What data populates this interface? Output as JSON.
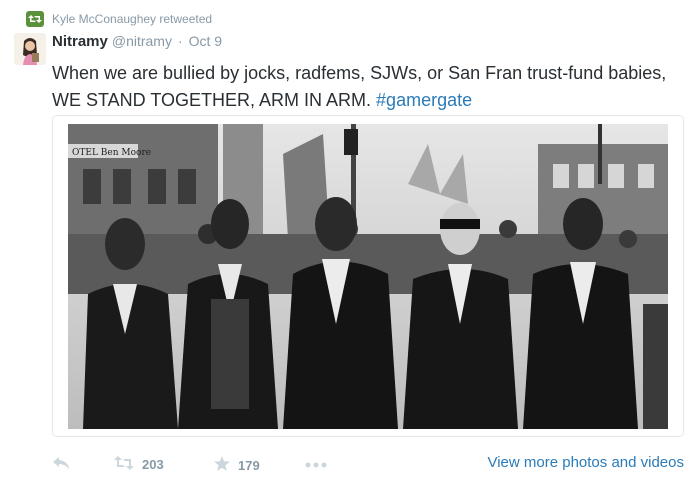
{
  "context": {
    "icon": "retweet-icon",
    "text": "Kyle McConaughey retweeted",
    "color": "#5c913b"
  },
  "tweet": {
    "name": "Nitramy",
    "handle": "@nitramy",
    "separator": "·",
    "date": "Oct 9",
    "text": "When we are bullied by jocks, radfems, SJWs, or San Fran trust-fund babies, WE STAND TOGETHER, ARM IN ARM. ",
    "hashtag": "#gamergate",
    "hashtag_color": "#2b7bb9"
  },
  "media": {
    "type": "black-and-white photograph of marchers walking arm in arm",
    "sign_text": "OTEL Ben Moore"
  },
  "actions": {
    "reply_icon": "reply-icon",
    "retweet_icon": "retweet-icon",
    "retweet_count": "203",
    "favorite_icon": "star-icon",
    "favorite_count": "179",
    "more_icon": "more-dots-icon",
    "view_more": "View more photos and videos",
    "link_color": "#2b7bb9"
  }
}
